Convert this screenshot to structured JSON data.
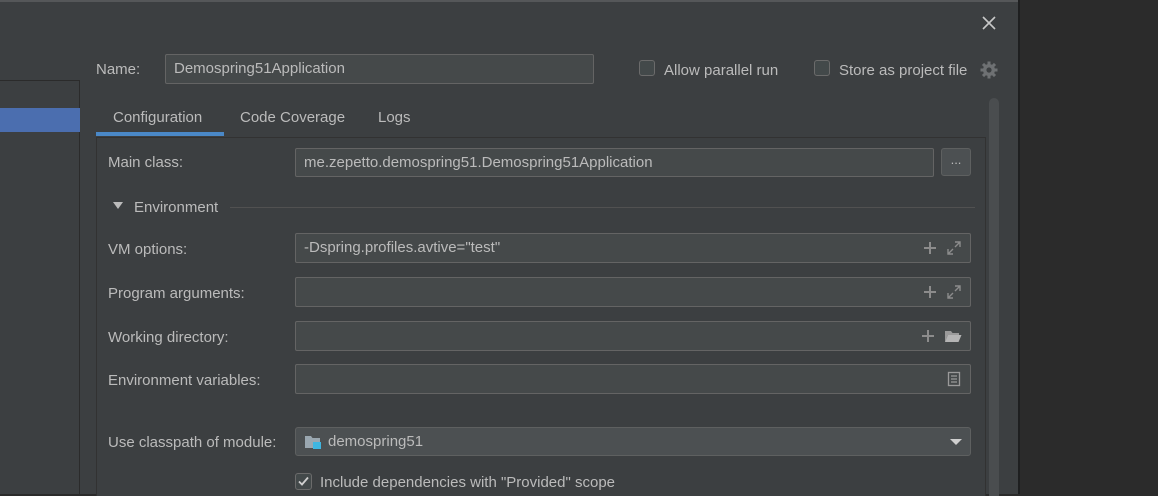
{
  "header": {
    "name_label": "Name:",
    "name_value": "Demospring51Application",
    "allow_parallel_label": "Allow parallel run",
    "store_project_label": "Store as project file"
  },
  "tabs": [
    {
      "label": "Configuration",
      "active": true
    },
    {
      "label": "Code Coverage",
      "active": false
    },
    {
      "label": "Logs",
      "active": false
    }
  ],
  "config": {
    "main_class_label": "Main class:",
    "main_class_value": "me.zepetto.demospring51.Demospring51Application",
    "browse_label": "...",
    "environment_label": "Environment",
    "vm_options_label": "VM options:",
    "vm_options_value": "-Dspring.profiles.avtive=\"test\"",
    "program_args_label": "Program arguments:",
    "program_args_value": "",
    "working_dir_label": "Working directory:",
    "working_dir_value": "",
    "env_vars_label": "Environment variables:",
    "env_vars_value": "",
    "classpath_label": "Use classpath of module:",
    "classpath_value": "demospring51",
    "include_provided_label": "Include dependencies with \"Provided\" scope",
    "include_provided_checked": true
  },
  "colors": {
    "accent": "#4a88c7",
    "selection": "#4b6eaf",
    "panel_bg": "#3c3f41",
    "field_bg": "#45494a"
  },
  "icons": [
    "close-icon",
    "gear-icon",
    "plus-icon",
    "expand-icon",
    "folder-open-icon",
    "document-icon",
    "module-folder-icon",
    "chevron-down-icon",
    "check-icon",
    "triangle-down-icon"
  ]
}
